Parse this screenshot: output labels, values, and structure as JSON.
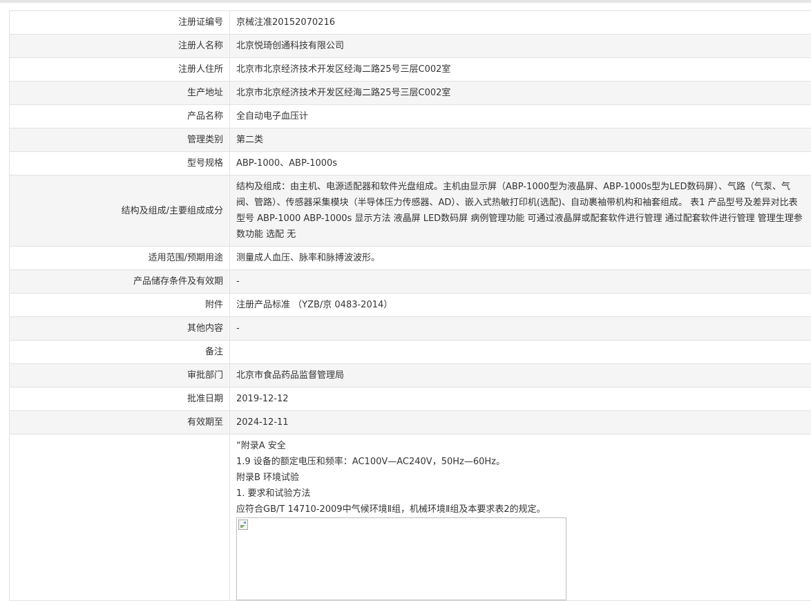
{
  "rows": [
    {
      "label": "注册证编号",
      "value": "京械注准20152070216"
    },
    {
      "label": "注册人名称",
      "value": "北京悦琦创通科技有限公司"
    },
    {
      "label": "注册人住所",
      "value": "北京市北京经济技术开发区经海二路25号三层C002室"
    },
    {
      "label": "生产地址",
      "value": "北京市北京经济技术开发区经海二路25号三层C002室"
    },
    {
      "label": "产品名称",
      "value": "全自动电子血压计"
    },
    {
      "label": "管理类别",
      "value": "第二类"
    },
    {
      "label": "型号规格",
      "value": "ABP-1000、ABP-1000s"
    },
    {
      "label": "结构及组成/主要组成成分",
      "value": "结构及组成：由主机、电源适配器和软件光盘组成。主机由显示屏（ABP-1000型为液晶屏、ABP-1000s型为LED数码屏）、气路（气泵、气阀、管路）、传感器采集模块（半导体压力传感器、AD）、嵌入式热敏打印机(选配)、自动裹袖带机构和袖套组成。 表1 产品型号及差异对比表 型号 ABP-1000 ABP-1000s 显示方法 液晶屏 LED数码屏 病例管理功能 可通过液晶屏或配套软件进行管理 通过配套软件进行管理 管理生理参数功能 选配 无"
    },
    {
      "label": "适用范围/预期用途",
      "value": "测量成人血压、脉率和脉搏波波形。"
    },
    {
      "label": "产品储存条件及有效期",
      "value": "-"
    },
    {
      "label": "附件",
      "value": "注册产品标准 （YZB/京 0483-2014）"
    },
    {
      "label": "其他内容",
      "value": "-"
    },
    {
      "label": "备注",
      "value": ""
    },
    {
      "label": "审批部门",
      "value": "北京市食品药品监督管理局"
    },
    {
      "label": "批准日期",
      "value": "2019-12-12"
    },
    {
      "label": "有效期至",
      "value": "2024-12-11"
    }
  ],
  "notes": {
    "label": "",
    "lines": [
      "“附录A  安全",
      "1.9 设备的额定电压和频率：AC100V—AC240V，50Hz—60Hz。",
      "附录B  环境试验",
      "1. 要求和试验方法",
      "应符合GB/T 14710-2009中气候环境Ⅱ组，机械环境Ⅱ组及本要求表2的规定。"
    ],
    "image_icon": "broken-image-icon"
  }
}
